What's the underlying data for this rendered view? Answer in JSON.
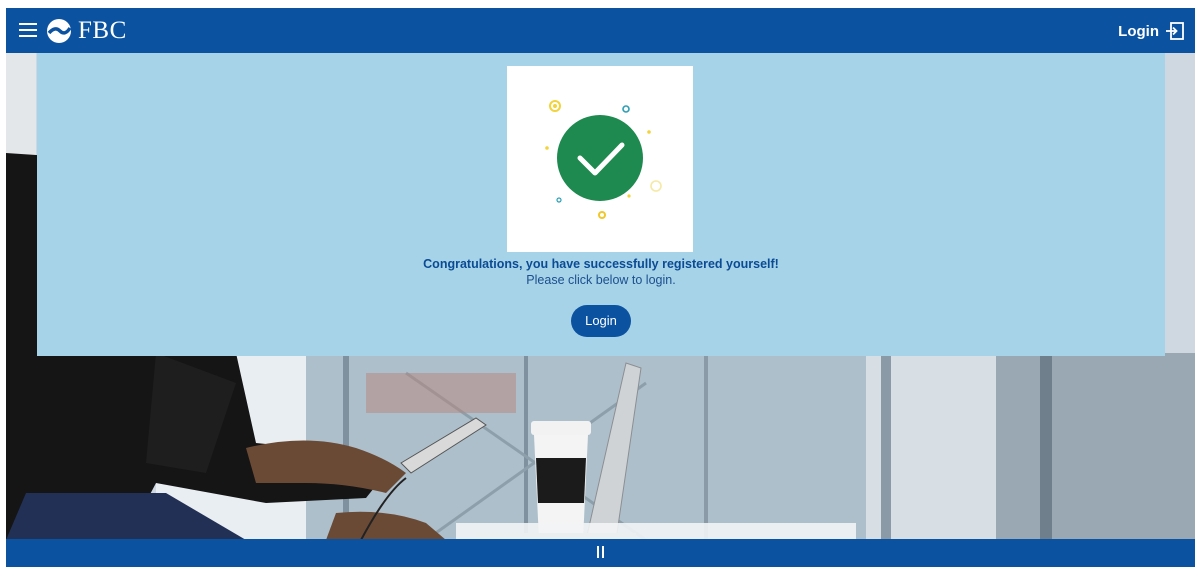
{
  "header": {
    "brand": "FBC",
    "login_label": "Login",
    "menu_icon": "hamburger-menu-icon",
    "logo_icon": "fbc-logo-icon",
    "login_icon": "sign-in-icon"
  },
  "success": {
    "title": "Congratulations, you have successfully registered yourself!",
    "subtitle": "Please click below to login.",
    "button_label": "Login",
    "image_icon": "success-checkmark-icon"
  },
  "footer": {
    "control_icon": "pause-icon"
  },
  "colors": {
    "brand_blue": "#0b52a1",
    "panel_blue": "#a6d3e8",
    "success_green": "#1e8a4f",
    "title_blue": "#0b4b95"
  }
}
